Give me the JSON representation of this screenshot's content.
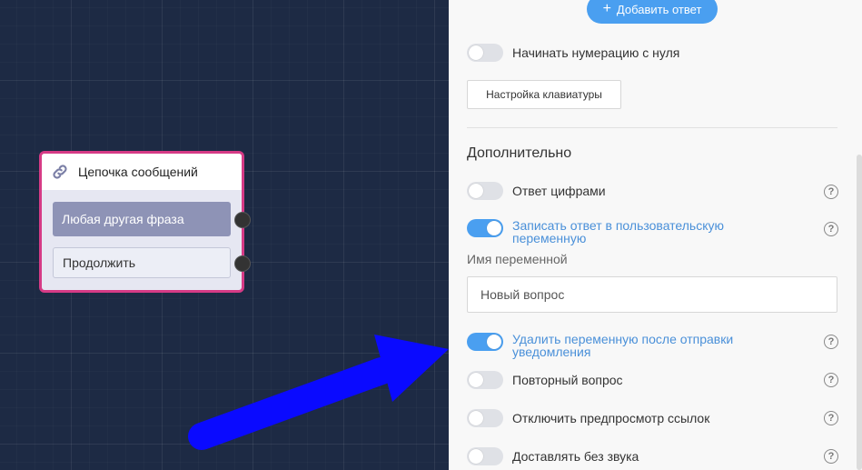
{
  "canvas": {
    "node": {
      "title": "Цепочка сообщений",
      "icon": "link-icon",
      "buttons": [
        {
          "label": "Любая другая фраза"
        },
        {
          "label": "Продолжить"
        }
      ]
    }
  },
  "panel": {
    "add_answer_label": "Добавить ответ",
    "start_numbering": {
      "label": "Начинать нумерацию с нуля",
      "on": false
    },
    "keyboard_button": "Настройка клавиатуры",
    "section_title": "Дополнительно",
    "options": [
      {
        "label": "Ответ цифрами",
        "on": false
      },
      {
        "label_line1": "Записать ответ в пользовательскую",
        "label_line2": "переменную",
        "on": true
      },
      {
        "label_line1": "Удалить переменную после отправки",
        "label_line2": "уведомления",
        "on": true
      },
      {
        "label": "Повторный вопрос",
        "on": false
      },
      {
        "label": "Отключить предпросмотр ссылок",
        "on": false
      },
      {
        "label": "Доставлять без звука",
        "on": false
      }
    ],
    "variable_name_label": "Имя переменной",
    "variable_name_value": "Новый вопрос",
    "help_glyph": "?"
  },
  "colors": {
    "accent": "#4a9ff0",
    "node_border": "#d63b86",
    "canvas_bg": "#1d2a44",
    "annotation_arrow": "#0a0aff"
  }
}
